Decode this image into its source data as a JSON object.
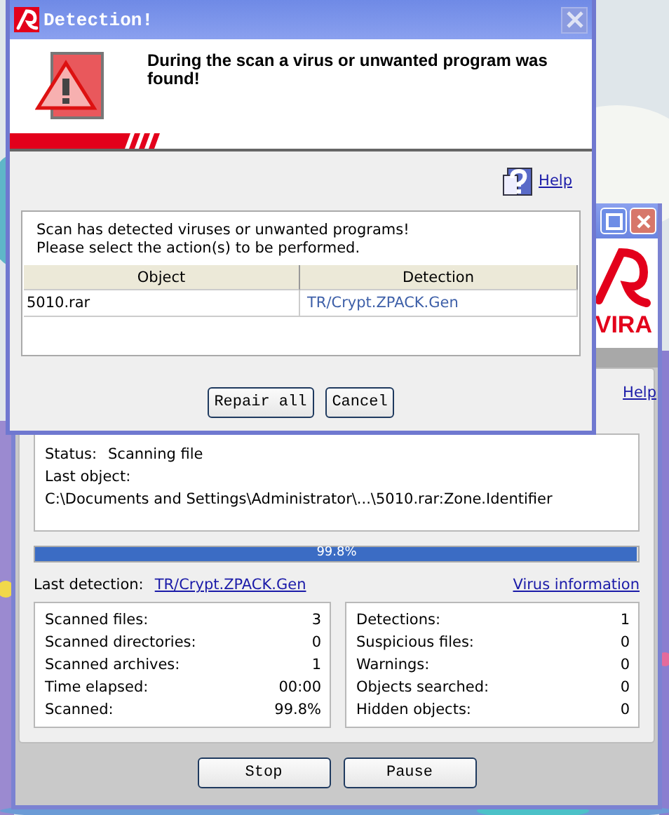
{
  "dialog": {
    "title": "Detection!",
    "message": "During the scan a virus or unwanted program was found!",
    "help_link": "Help",
    "info_lines": [
      "Scan has detected viruses or unwanted programs!",
      "Please select the action(s) to be performed."
    ],
    "table": {
      "columns": [
        "Object",
        "Detection"
      ],
      "rows": [
        [
          "5010.rar",
          "TR/Crypt.ZPACK.Gen"
        ]
      ]
    },
    "buttons": [
      "Repair all",
      "Cancel"
    ]
  },
  "scanner_window": {
    "logo_text": "VIRA",
    "help_link": "Help",
    "status": {
      "label": "Status:",
      "value": "Scanning file"
    },
    "last_object_label": "Last object:",
    "last_object_path": "C:\\Documents and Settings\\Administrator\\...\\5010.rar:Zone.Identifier",
    "progress": {
      "level": 0.998,
      "reading": "99.8%"
    },
    "last_detection": {
      "label": "Last detection:",
      "value": "TR/Crypt.ZPACK.Gen"
    },
    "virus_info_link": "Virus information",
    "stats_left": [
      {
        "label": "Scanned files:",
        "value": "3"
      },
      {
        "label": "Scanned directories:",
        "value": "0"
      },
      {
        "label": "Scanned archives:",
        "value": "1"
      },
      {
        "label": "Time elapsed:",
        "value": "00:00"
      },
      {
        "label": "Scanned:",
        "value": "99.8%"
      }
    ],
    "stats_right": [
      {
        "label": "Detections:",
        "value": "1"
      },
      {
        "label": "Suspicious files:",
        "value": "0"
      },
      {
        "label": "Warnings:",
        "value": "0"
      },
      {
        "label": "Objects searched:",
        "value": "0"
      },
      {
        "label": "Hidden objects:",
        "value": "0"
      }
    ],
    "buttons": [
      "Stop",
      "Pause"
    ]
  }
}
